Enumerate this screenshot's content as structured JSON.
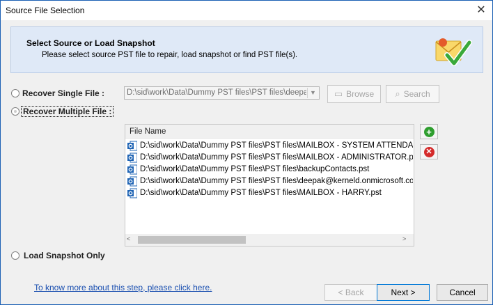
{
  "window": {
    "title": "Source File Selection",
    "close_glyph": "✕"
  },
  "banner": {
    "title": "Select Source or Load Snapshot",
    "subtitle": "Please select source PST file to repair, load snapshot or find PST file(s).",
    "icon": "mail-check-icon"
  },
  "options": {
    "single_file_label": "Recover Single File :",
    "multiple_file_label": "Recover Multiple File :",
    "snapshot_label": "Load Snapshot Only",
    "selected": "multiple"
  },
  "single_file": {
    "path_value": "D:\\sid\\work\\Data\\Dummy PST files\\PST files\\deepak",
    "browse_label": "Browse",
    "search_label": "Search"
  },
  "file_list": {
    "column_header": "File Name",
    "rows": [
      "D:\\sid\\work\\Data\\Dummy PST files\\PST files\\MAILBOX - SYSTEM ATTENDANT.pst",
      "D:\\sid\\work\\Data\\Dummy PST files\\PST files\\MAILBOX - ADMINISTRATOR.pst",
      "D:\\sid\\work\\Data\\Dummy PST files\\PST files\\backupContacts.pst",
      "D:\\sid\\work\\Data\\Dummy PST files\\PST files\\deepak@kerneld.onmicrosoft.com.pst",
      "D:\\sid\\work\\Data\\Dummy PST files\\PST files\\MAILBOX - HARRY.pst"
    ],
    "scroll_left_glyph": "<",
    "scroll_right_glyph": ">"
  },
  "footer": {
    "help_link": "To know more about this step, please click here.",
    "back_label": "< Back",
    "next_label": "Next >",
    "cancel_label": "Cancel"
  },
  "colors": {
    "accent": "#0078d7",
    "banner_bg": "#dfe9f7",
    "add_green": "#2e9e2e",
    "remove_red": "#d42a2a",
    "link_blue": "#1a4fb0"
  }
}
